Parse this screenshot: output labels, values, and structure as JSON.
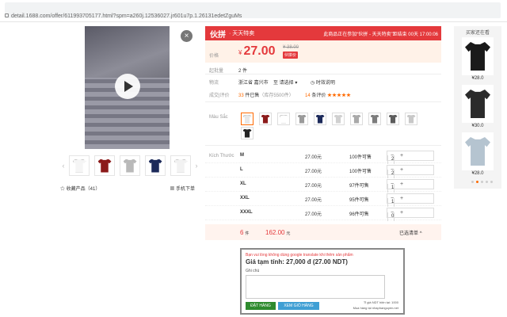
{
  "browser": {
    "url": "detail.1688.com/offer/611993705177.html?spm=a260j.12536027.jr601u7p.1.26131edetZguMs"
  },
  "media": {
    "close_glyph": "×"
  },
  "thumbnails": [
    {
      "color": "#f5f5f5"
    },
    {
      "color": "#8b1a1a"
    },
    {
      "color": "#b9b9b9"
    },
    {
      "color": "#1c2a5a"
    },
    {
      "color": "#f2f2f2"
    }
  ],
  "actions": {
    "favorite_label": "收藏产品（41）",
    "mobile_label": "手机下单"
  },
  "banner": {
    "logo": "伙拼",
    "title": "· 天天特卖",
    "promo": "此商品正在参加“伙拼 - 天天特卖”距结束 00天 17:00:06"
  },
  "price": {
    "label": "价格",
    "currency": "¥",
    "value": "27.00",
    "old": "¥ 38.00",
    "badge": "伙拼价",
    "min_label": "起批量",
    "min_value": "2 件"
  },
  "logistics": {
    "label": "物流",
    "origin": "浙江省 嘉兴市",
    "to": "至 请选择",
    "arrow": "▾",
    "timing": "时效说明"
  },
  "stats": {
    "label": "成交|评价",
    "deals_num": "33",
    "deals_text": "件已售",
    "stock": "（库存5500件）",
    "reviews_num": "14",
    "reviews_text": "条评价",
    "stars": "★★★★★"
  },
  "colors": {
    "label": "Màu Sắc",
    "swatches": [
      "#e8e8e8",
      "#8b1a1a",
      "#ffffff",
      "#9a9a9a",
      "#1c2a5a",
      "#d0d0d0",
      "#a9a9a9",
      "#7c7c7c",
      "#5c5c5c",
      "#c8c8c8",
      "#222222"
    ]
  },
  "sizes": {
    "label": "Kích Thước",
    "rows": [
      {
        "size": "M",
        "price": "27.00元",
        "stock": "100件可售",
        "qty": "2"
      },
      {
        "size": "L",
        "price": "27.00元",
        "stock": "100件可售",
        "qty": "2"
      },
      {
        "size": "XL",
        "price": "27.00元",
        "stock": "97件可售",
        "qty": "1"
      },
      {
        "size": "XXL",
        "price": "27.00元",
        "stock": "95件可售",
        "qty": "1"
      },
      {
        "size": "XXXL",
        "price": "27.00元",
        "stock": "96件可售",
        "qty": "0"
      }
    ],
    "minus": "−",
    "plus": "+"
  },
  "total": {
    "count": "6",
    "count_unit": "件",
    "amount": "162.00",
    "amount_unit": "元",
    "selected": "已选清单",
    "caret": "^"
  },
  "addon": {
    "note": "Bạn vui lòng không dùng google translate khi thêm sản phẩm",
    "estimate": "Giá tạm tính: 27,000 đ (27.00 NDT)",
    "note_label": "Ghi chú",
    "order_button": "ĐẶT HÀNG",
    "cart_button": "XEM GIỎ HÀNG",
    "rate_line": "Tỉ giá NDT hiện tại: 1000",
    "powered": "Mua hàng tại nhaphanguyen.net"
  },
  "sidebar": {
    "title": "买家还在看",
    "items": [
      {
        "price": "¥28.0",
        "color": "#1a1a1a"
      },
      {
        "price": "¥30.0",
        "color": "#2b2b2b"
      },
      {
        "price": "¥28.0",
        "color": "#b5c4d0"
      }
    ]
  }
}
